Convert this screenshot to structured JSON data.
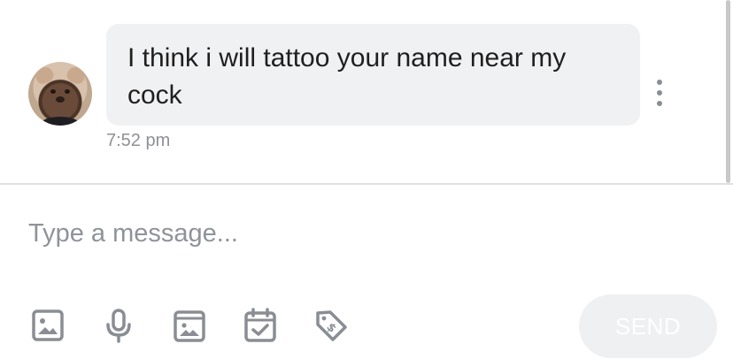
{
  "conversation": {
    "message": {
      "text": "I think i will tattoo your name near my cock",
      "time": "7:52 pm"
    }
  },
  "composer": {
    "placeholder": "Type a message...",
    "send_label": "SEND",
    "tools": [
      "image-icon",
      "microphone-icon",
      "gallery-icon",
      "calendar-check-icon",
      "price-tag-icon"
    ]
  },
  "colors": {
    "bubble": "#f0f1f3",
    "icon": "#8a8d93",
    "send_button_bg": "#eef0f2",
    "timestamp": "#8e9096"
  }
}
